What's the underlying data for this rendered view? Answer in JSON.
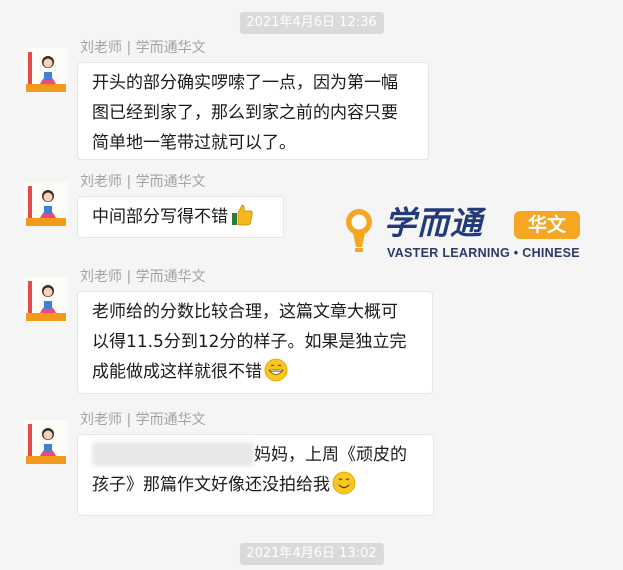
{
  "timestamps": [
    "2021年4月6日 12:36",
    "2021年4月6日 13:02"
  ],
  "sender_name": "刘老师 | 学而通华文",
  "messages": [
    {
      "text": "开头的部分确实啰嗦了一点，因为第一幅\n图已经到家了，那么到家之前的内容只要\n简单地一笔带过就可以了。"
    },
    {
      "text": "中间部分写得不错",
      "emoji": "thumbs-up-icon"
    },
    {
      "text": "老师给的分数比较合理，这篇文章大概可\n以得11.5分到12分的样子。如果是独立完\n成能做成这样就很不错",
      "emoji": "grinning-face-icon"
    },
    {
      "text_line1": "妈妈，上周《顽皮的",
      "text_line2": "孩子》那篇作文好像还没拍给我",
      "emoji": "smiling-face-icon"
    }
  ],
  "watermark": {
    "brand": "学而通",
    "tag": "华文",
    "subtitle": "VASTER LEARNING • CHINESE"
  }
}
